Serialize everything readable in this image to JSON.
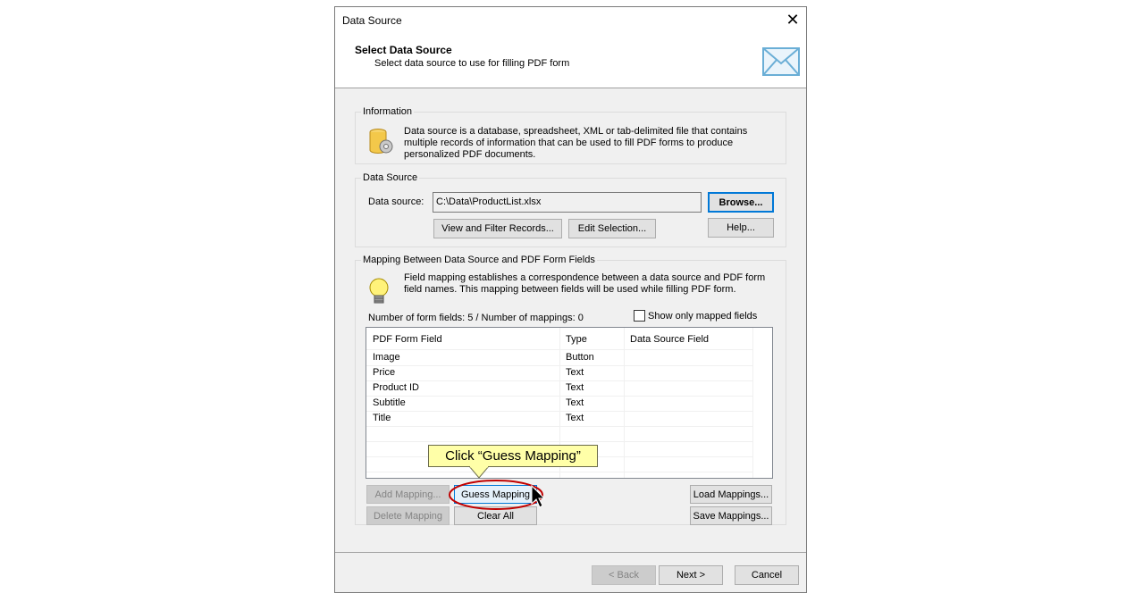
{
  "window": {
    "title": "Data Source"
  },
  "header": {
    "title": "Select Data Source",
    "subtitle": "Select data source to use for filling PDF form"
  },
  "information": {
    "legend": "Information",
    "text": "Data source is a database, spreadsheet, XML or tab-delimited file that contains multiple records of information that can be used to fill PDF forms to produce personalized PDF documents."
  },
  "data_source": {
    "legend": "Data Source",
    "label": "Data source:",
    "value": "C:\\Data\\ProductList.xlsx",
    "browse_label": "Browse...",
    "help_label": "Help...",
    "view_filter_label": "View and Filter Records...",
    "edit_selection_label": "Edit Selection..."
  },
  "mapping": {
    "legend": "Mapping Between Data Source and PDF Form Fields",
    "text": "Field mapping establishes a correspondence between a data source and PDF form field names. This mapping between fields will be used while filling PDF form.",
    "count_text": "Number of form fields: 5 / Number of mappings: 0",
    "show_only_mapped_label": "Show only mapped fields",
    "columns": [
      "PDF Form Field",
      "Type",
      "Data Source Field"
    ],
    "rows": [
      {
        "field": "Image",
        "type": "Button",
        "source": ""
      },
      {
        "field": "Price",
        "type": "Text",
        "source": ""
      },
      {
        "field": "Product ID",
        "type": "Text",
        "source": ""
      },
      {
        "field": "Subtitle",
        "type": "Text",
        "source": ""
      },
      {
        "field": "Title",
        "type": "Text",
        "source": ""
      }
    ],
    "add_mapping_label": "Add Mapping...",
    "delete_mapping_label": "Delete Mapping",
    "guess_mapping_label": "Guess Mapping",
    "clear_all_label": "Clear All",
    "load_mappings_label": "Load Mappings...",
    "save_mappings_label": "Save Mappings..."
  },
  "callout": {
    "text": "Click “Guess Mapping”"
  },
  "footer": {
    "back_label": "< Back",
    "next_label": "Next >",
    "cancel_label": "Cancel"
  },
  "colors": {
    "accent": "#0078d7",
    "callout_bg": "#ffffa8",
    "highlight_ring": "#c00000"
  }
}
